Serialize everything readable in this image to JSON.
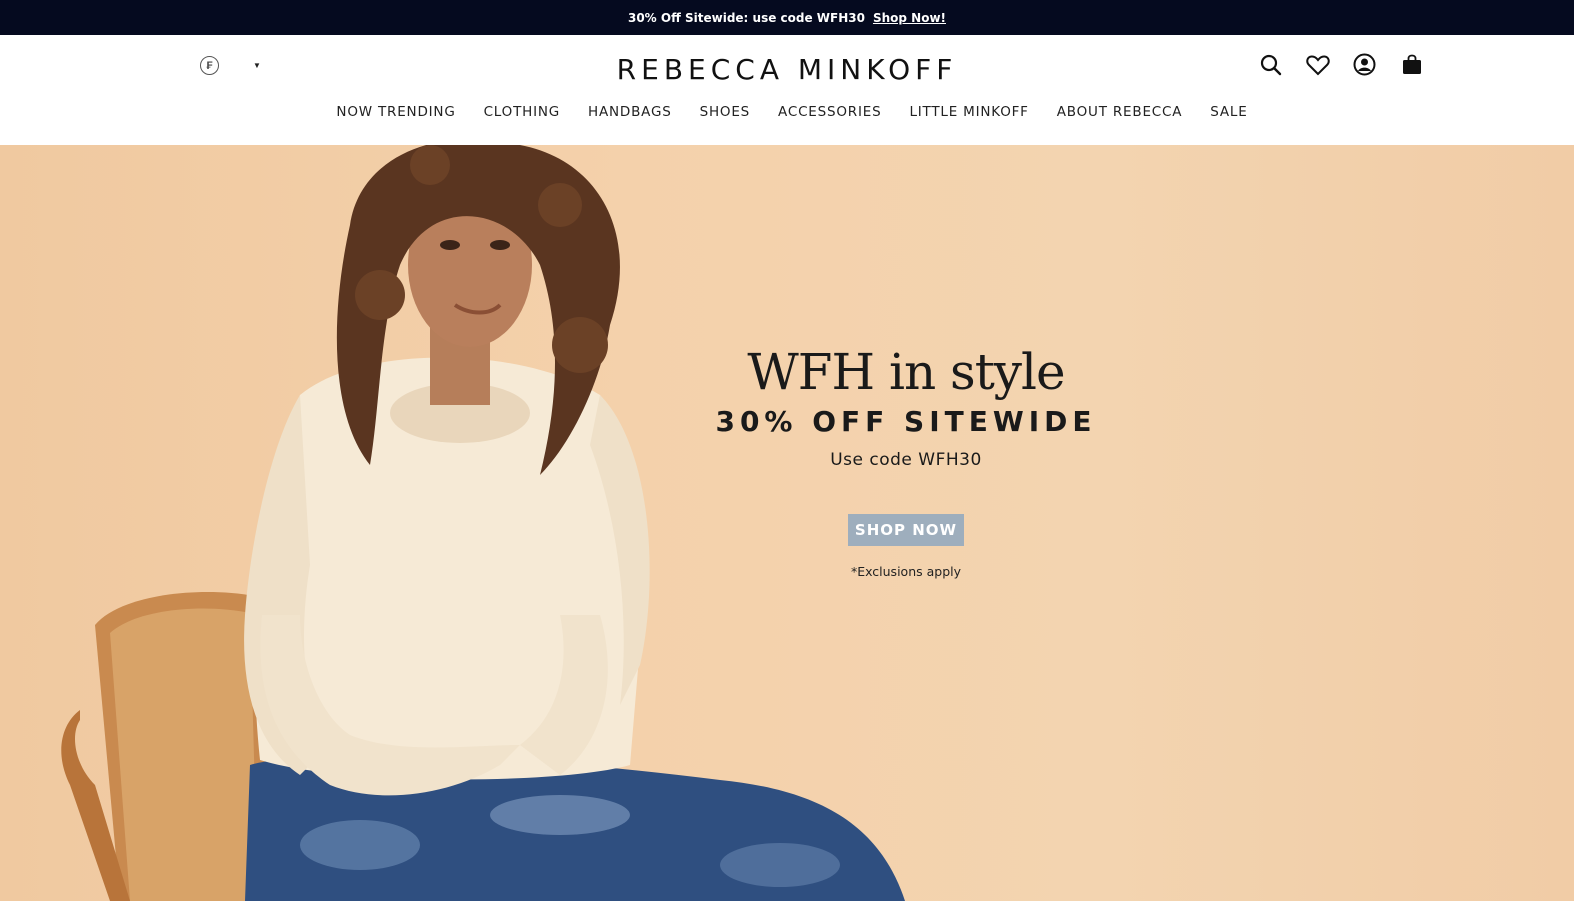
{
  "promo": {
    "text": "30% Off Sitewide: use code WFH30",
    "link": "Shop Now!"
  },
  "header": {
    "logo": "REBECCA MINKOFF",
    "currency_glyph": "₣",
    "icons": [
      "search-icon",
      "heart-icon",
      "account-icon",
      "bag-icon"
    ]
  },
  "nav": {
    "items": [
      {
        "label": "NOW TRENDING"
      },
      {
        "label": "CLOTHING"
      },
      {
        "label": "HANDBAGS"
      },
      {
        "label": "SHOES"
      },
      {
        "label": "ACCESSORIES"
      },
      {
        "label": "LITTLE MINKOFF"
      },
      {
        "label": "ABOUT REBECCA"
      },
      {
        "label": "SALE"
      }
    ]
  },
  "hero": {
    "headline": "WFH in style",
    "subheadline": "30% OFF SITEWIDE",
    "code_text": "Use code WFH30",
    "cta": "SHOP NOW",
    "note": "*Exclusions apply"
  },
  "colors": {
    "promo_bg": "#050a1f",
    "hero_bg": "#f3d0aa",
    "cta_bg": "#9eaebd",
    "sweater": "#f6ead6",
    "jeans": "#2f4f80"
  }
}
